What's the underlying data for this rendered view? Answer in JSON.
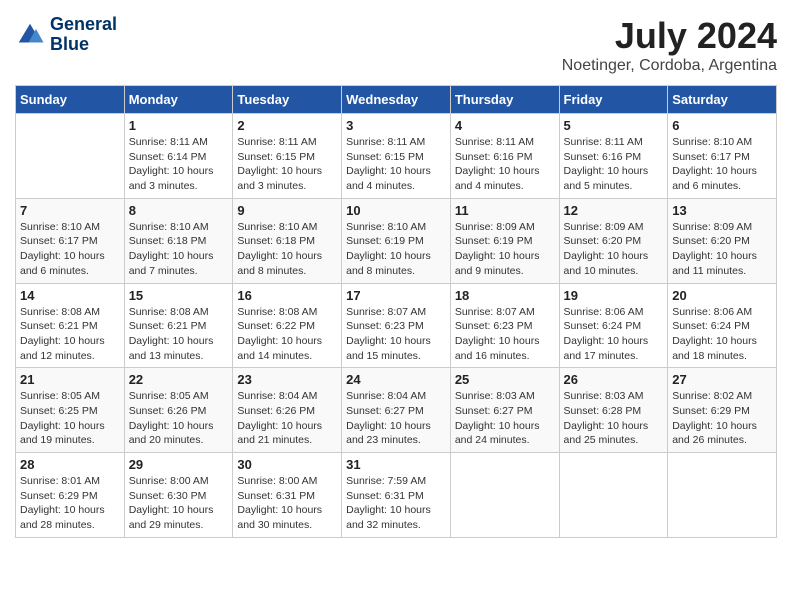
{
  "header": {
    "logo_line1": "General",
    "logo_line2": "Blue",
    "month_year": "July 2024",
    "location": "Noetinger, Cordoba, Argentina"
  },
  "days_of_week": [
    "Sunday",
    "Monday",
    "Tuesday",
    "Wednesday",
    "Thursday",
    "Friday",
    "Saturday"
  ],
  "weeks": [
    [
      {
        "num": "",
        "info": ""
      },
      {
        "num": "1",
        "info": "Sunrise: 8:11 AM\nSunset: 6:14 PM\nDaylight: 10 hours\nand 3 minutes."
      },
      {
        "num": "2",
        "info": "Sunrise: 8:11 AM\nSunset: 6:15 PM\nDaylight: 10 hours\nand 3 minutes."
      },
      {
        "num": "3",
        "info": "Sunrise: 8:11 AM\nSunset: 6:15 PM\nDaylight: 10 hours\nand 4 minutes."
      },
      {
        "num": "4",
        "info": "Sunrise: 8:11 AM\nSunset: 6:16 PM\nDaylight: 10 hours\nand 4 minutes."
      },
      {
        "num": "5",
        "info": "Sunrise: 8:11 AM\nSunset: 6:16 PM\nDaylight: 10 hours\nand 5 minutes."
      },
      {
        "num": "6",
        "info": "Sunrise: 8:10 AM\nSunset: 6:17 PM\nDaylight: 10 hours\nand 6 minutes."
      }
    ],
    [
      {
        "num": "7",
        "info": "Sunrise: 8:10 AM\nSunset: 6:17 PM\nDaylight: 10 hours\nand 6 minutes."
      },
      {
        "num": "8",
        "info": "Sunrise: 8:10 AM\nSunset: 6:18 PM\nDaylight: 10 hours\nand 7 minutes."
      },
      {
        "num": "9",
        "info": "Sunrise: 8:10 AM\nSunset: 6:18 PM\nDaylight: 10 hours\nand 8 minutes."
      },
      {
        "num": "10",
        "info": "Sunrise: 8:10 AM\nSunset: 6:19 PM\nDaylight: 10 hours\nand 8 minutes."
      },
      {
        "num": "11",
        "info": "Sunrise: 8:09 AM\nSunset: 6:19 PM\nDaylight: 10 hours\nand 9 minutes."
      },
      {
        "num": "12",
        "info": "Sunrise: 8:09 AM\nSunset: 6:20 PM\nDaylight: 10 hours\nand 10 minutes."
      },
      {
        "num": "13",
        "info": "Sunrise: 8:09 AM\nSunset: 6:20 PM\nDaylight: 10 hours\nand 11 minutes."
      }
    ],
    [
      {
        "num": "14",
        "info": "Sunrise: 8:08 AM\nSunset: 6:21 PM\nDaylight: 10 hours\nand 12 minutes."
      },
      {
        "num": "15",
        "info": "Sunrise: 8:08 AM\nSunset: 6:21 PM\nDaylight: 10 hours\nand 13 minutes."
      },
      {
        "num": "16",
        "info": "Sunrise: 8:08 AM\nSunset: 6:22 PM\nDaylight: 10 hours\nand 14 minutes."
      },
      {
        "num": "17",
        "info": "Sunrise: 8:07 AM\nSunset: 6:23 PM\nDaylight: 10 hours\nand 15 minutes."
      },
      {
        "num": "18",
        "info": "Sunrise: 8:07 AM\nSunset: 6:23 PM\nDaylight: 10 hours\nand 16 minutes."
      },
      {
        "num": "19",
        "info": "Sunrise: 8:06 AM\nSunset: 6:24 PM\nDaylight: 10 hours\nand 17 minutes."
      },
      {
        "num": "20",
        "info": "Sunrise: 8:06 AM\nSunset: 6:24 PM\nDaylight: 10 hours\nand 18 minutes."
      }
    ],
    [
      {
        "num": "21",
        "info": "Sunrise: 8:05 AM\nSunset: 6:25 PM\nDaylight: 10 hours\nand 19 minutes."
      },
      {
        "num": "22",
        "info": "Sunrise: 8:05 AM\nSunset: 6:26 PM\nDaylight: 10 hours\nand 20 minutes."
      },
      {
        "num": "23",
        "info": "Sunrise: 8:04 AM\nSunset: 6:26 PM\nDaylight: 10 hours\nand 21 minutes."
      },
      {
        "num": "24",
        "info": "Sunrise: 8:04 AM\nSunset: 6:27 PM\nDaylight: 10 hours\nand 23 minutes."
      },
      {
        "num": "25",
        "info": "Sunrise: 8:03 AM\nSunset: 6:27 PM\nDaylight: 10 hours\nand 24 minutes."
      },
      {
        "num": "26",
        "info": "Sunrise: 8:03 AM\nSunset: 6:28 PM\nDaylight: 10 hours\nand 25 minutes."
      },
      {
        "num": "27",
        "info": "Sunrise: 8:02 AM\nSunset: 6:29 PM\nDaylight: 10 hours\nand 26 minutes."
      }
    ],
    [
      {
        "num": "28",
        "info": "Sunrise: 8:01 AM\nSunset: 6:29 PM\nDaylight: 10 hours\nand 28 minutes."
      },
      {
        "num": "29",
        "info": "Sunrise: 8:00 AM\nSunset: 6:30 PM\nDaylight: 10 hours\nand 29 minutes."
      },
      {
        "num": "30",
        "info": "Sunrise: 8:00 AM\nSunset: 6:31 PM\nDaylight: 10 hours\nand 30 minutes."
      },
      {
        "num": "31",
        "info": "Sunrise: 7:59 AM\nSunset: 6:31 PM\nDaylight: 10 hours\nand 32 minutes."
      },
      {
        "num": "",
        "info": ""
      },
      {
        "num": "",
        "info": ""
      },
      {
        "num": "",
        "info": ""
      }
    ]
  ]
}
